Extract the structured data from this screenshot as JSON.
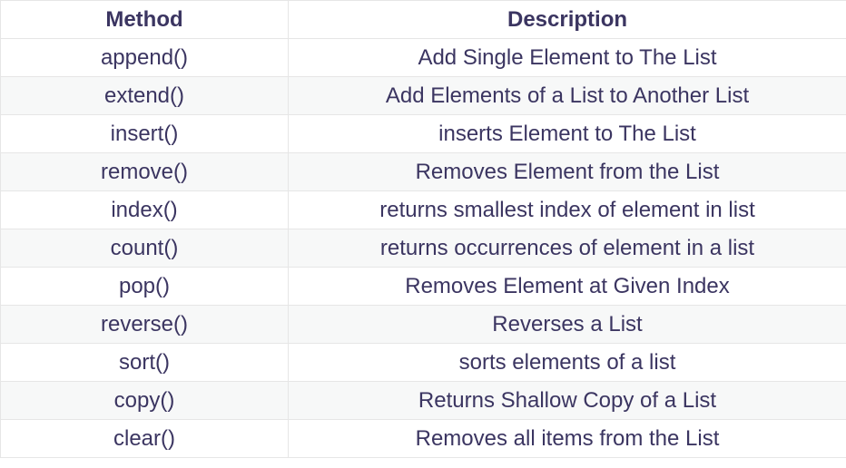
{
  "table": {
    "headers": {
      "method": "Method",
      "description": "Description"
    },
    "rows": [
      {
        "method": "append()",
        "description": "Add Single Element to The List"
      },
      {
        "method": "extend()",
        "description": "Add Elements of a List to Another List"
      },
      {
        "method": "insert()",
        "description": "inserts Element to The List"
      },
      {
        "method": "remove()",
        "description": "Removes Element from the List"
      },
      {
        "method": "index()",
        "description": "returns smallest index of element in list"
      },
      {
        "method": "count()",
        "description": "returns occurrences of element in a list"
      },
      {
        "method": "pop()",
        "description": "Removes Element at Given Index"
      },
      {
        "method": "reverse()",
        "description": "Reverses a List"
      },
      {
        "method": "sort()",
        "description": "sorts elements of a list"
      },
      {
        "method": "copy()",
        "description": "Returns Shallow Copy of a List"
      },
      {
        "method": "clear()",
        "description": "Removes all items from the List"
      }
    ]
  },
  "colors": {
    "text": "#3b3561",
    "border": "#e6e6e6",
    "stripe": "#f7f8f8",
    "background": "#ffffff"
  }
}
